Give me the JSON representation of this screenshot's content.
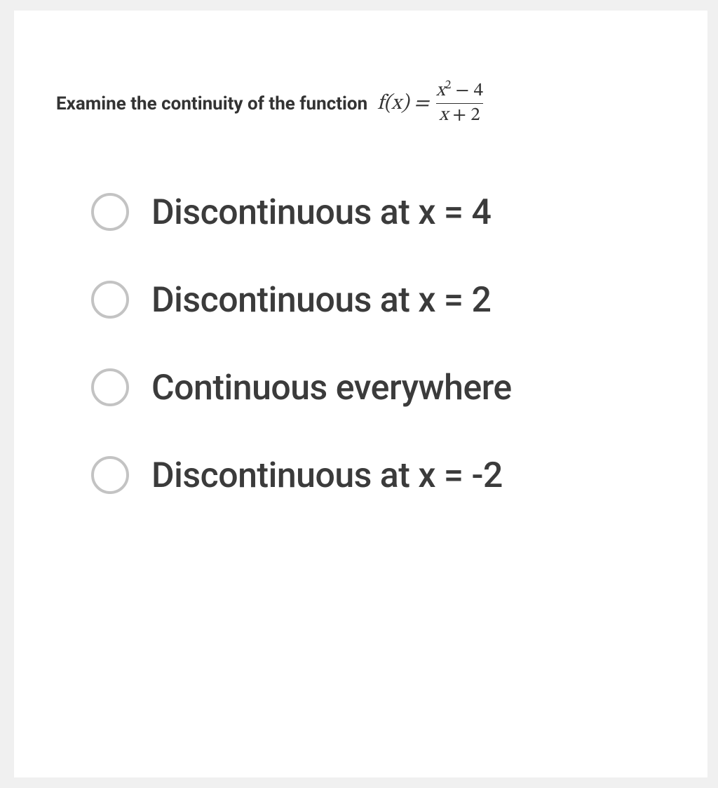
{
  "question": {
    "prefix": "Examine the continuity of the function",
    "lhs": "f(x) =",
    "numerator": "x² − 4",
    "denominator": "x + 2"
  },
  "options": [
    {
      "label": "Discontinuous at x = 4"
    },
    {
      "label": "Discontinuous at x = 2"
    },
    {
      "label": "Continuous everywhere"
    },
    {
      "label": "Discontinuous at x = -2"
    }
  ]
}
